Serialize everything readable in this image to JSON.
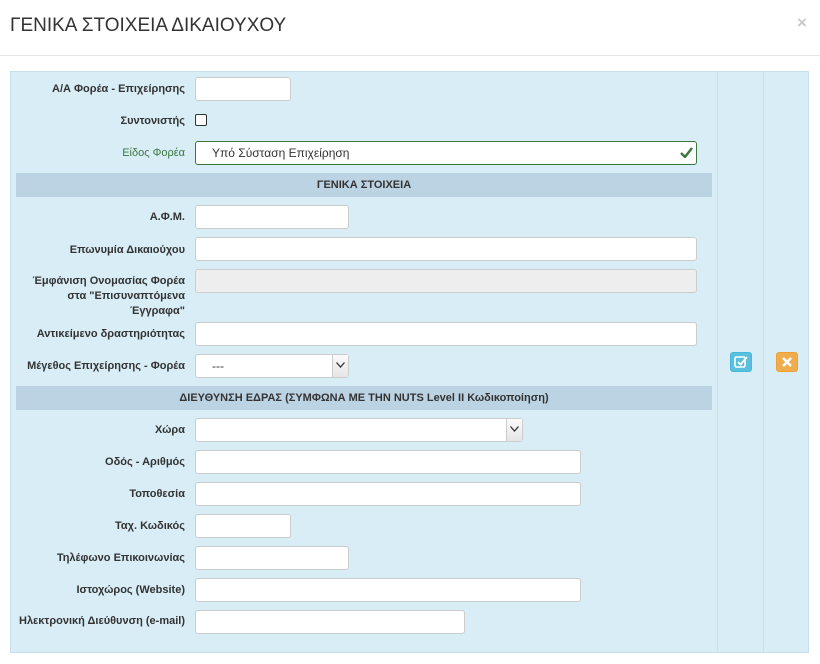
{
  "modal": {
    "title": "ΓΕΝΙΚΑ ΣΤΟΙΧΕΙΑ ΔΙΚΑΙΟΥΧΟΥ",
    "close_label": "×"
  },
  "form": {
    "aa_label": "Α/Α Φορέα - Επιχείρησης",
    "aa_value": "",
    "coordinator_label": "Συντονιστής",
    "coordinator_checked": false,
    "type_label": "Είδος Φορέα",
    "type_value": "Υπό Σύσταση Επιχείρηση",
    "section_general": "ΓΕΝΙΚΑ ΣΤΟΙΧΕΙΑ",
    "afm_label": "Α.Φ.Μ.",
    "afm_value": "",
    "name_label": "Επωνυμία Δικαιούχου",
    "name_value": "",
    "display_name_label": "Έμφάνιση Ονομασίας Φορέα στα \"Επισυναπτόμενα Έγγραφα\"",
    "display_name_value": "",
    "activity_label": "Αντικείμενο δραστηριότητας",
    "activity_value": "",
    "size_label": "Μέγεθος Επιχείρησης - Φορέα",
    "size_value": "---",
    "section_address": "ΔΙΕΥΘΥΝΣΗ ΕΔΡΑΣ (ΣΥΜΦΩΝΑ ΜΕ ΤΗΝ NUTS Level II Κωδικοποίηση)",
    "country_label": "Χώρα",
    "country_value": "",
    "street_label": "Οδός - Αριθμός",
    "street_value": "",
    "location_label": "Τοποθεσία",
    "location_value": "",
    "zip_label": "Ταχ. Κωδικός",
    "zip_value": "",
    "phone_label": "Τηλέφωνο Επικοινωνίας",
    "phone_value": "",
    "website_label": "Ιστοχώρος (Website)",
    "website_value": "",
    "email_label": "Ηλεκτρονική Διεύθυνση (e-mail)",
    "email_value": ""
  },
  "actions": {
    "edit_icon": "edit-check-icon",
    "delete_icon": "close-icon"
  },
  "colors": {
    "panel_bg": "#d9edf7",
    "section_bg": "#bcd3e3",
    "success": "#3c763d",
    "info": "#5bc0de",
    "warning": "#f0ad4e"
  }
}
